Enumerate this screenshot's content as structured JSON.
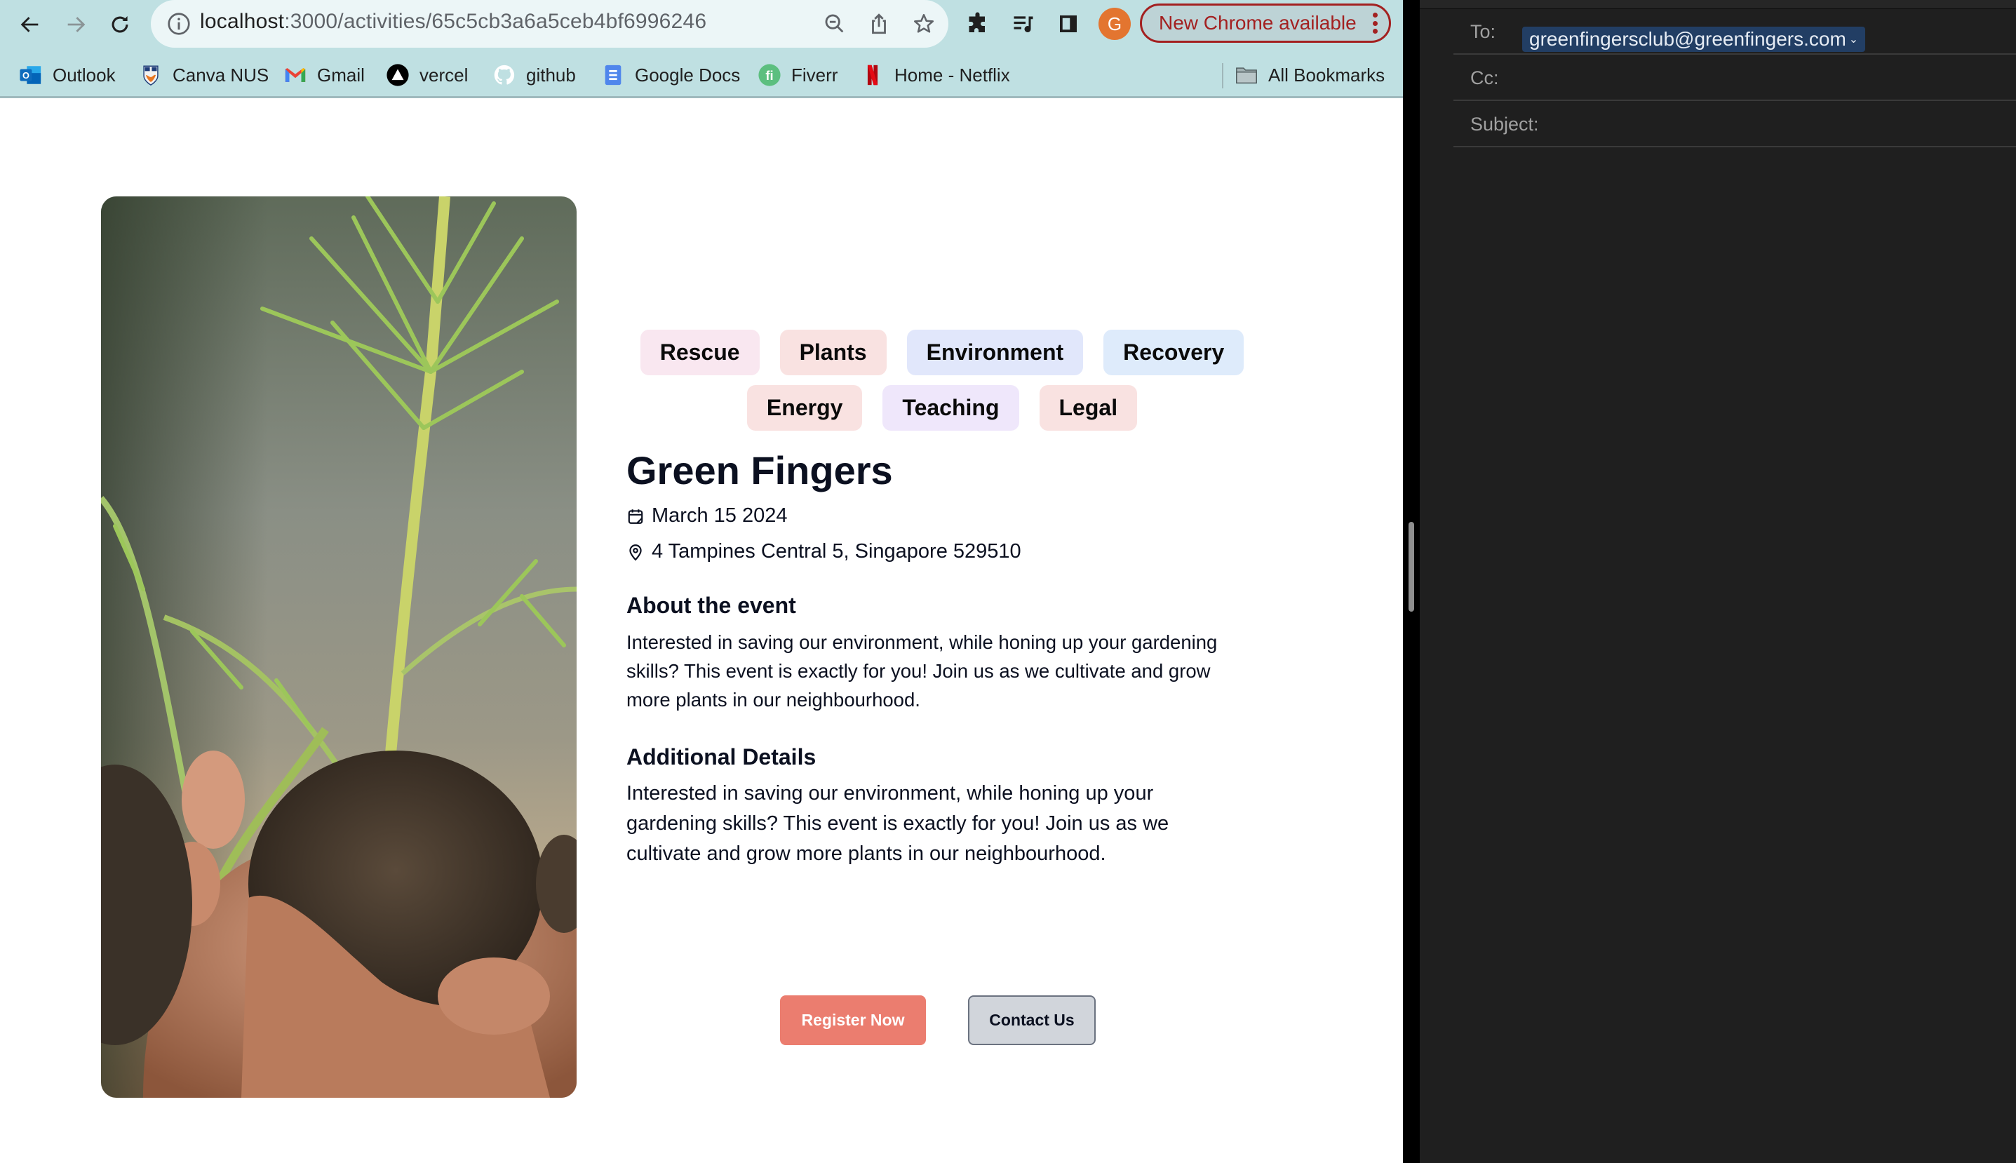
{
  "browser": {
    "url_host": "localhost",
    "url_path": ":3000/activities/65c5cb3a6a5ceb4bf6996246",
    "update_label": "New Chrome available",
    "profile_initial": "G",
    "bookmarks": [
      {
        "label": "Outlook",
        "icon": "outlook-icon"
      },
      {
        "label": "Canva NUS",
        "icon": "nus-crest-icon"
      },
      {
        "label": "Gmail",
        "icon": "gmail-icon"
      },
      {
        "label": "vercel",
        "icon": "vercel-icon"
      },
      {
        "label": "github",
        "icon": "github-icon"
      },
      {
        "label": "Google Docs",
        "icon": "google-docs-icon"
      },
      {
        "label": "Fiverr",
        "icon": "fiverr-icon"
      },
      {
        "label": "Home - Netflix",
        "icon": "netflix-icon"
      }
    ],
    "all_bookmarks_label": "All Bookmarks"
  },
  "event": {
    "tags": [
      {
        "label": "Rescue",
        "color": "#f9e7f0"
      },
      {
        "label": "Plants",
        "color": "#f9e2e1"
      },
      {
        "label": "Environment",
        "color": "#e1e7fb"
      },
      {
        "label": "Recovery",
        "color": "#deebfb"
      },
      {
        "label": "Energy",
        "color": "#f9e2e1"
      },
      {
        "label": "Teaching",
        "color": "#efe7fb"
      },
      {
        "label": "Legal",
        "color": "#f9e2e1"
      }
    ],
    "title": "Green Fingers",
    "date": "March 15 2024",
    "location": "4 Tampines Central 5, Singapore 529510",
    "about_heading": "About the event",
    "about_text": "Interested in saving our environment, while honing up your gardening skills? This event is exactly for you! Join us as we cultivate and grow more plants in our neighbourhood.",
    "details_heading": "Additional Details",
    "details_text": "Interested in saving our environment, while honing up your gardening skills? This event is exactly for you! Join us as we cultivate and grow more plants in our neighbourhood.",
    "register_label": "Register Now",
    "contact_label": "Contact Us",
    "image_alt": "Hands holding a seedling in a soil ball"
  },
  "mail": {
    "to_label": "To:",
    "to_value": "greenfingersclub@greenfingers.com",
    "cc_label": "Cc:",
    "cc_value": "",
    "subject_label": "Subject:",
    "subject_value": ""
  },
  "colors": {
    "toolbar_bg": "#bfe0e2",
    "register_button": "#eb7d6f",
    "contact_button": "#d1d5db",
    "update_accent": "#a32020",
    "profile_avatar": "#e37530",
    "to_chip": "#223e64",
    "mail_bg": "#1f1f1f"
  }
}
